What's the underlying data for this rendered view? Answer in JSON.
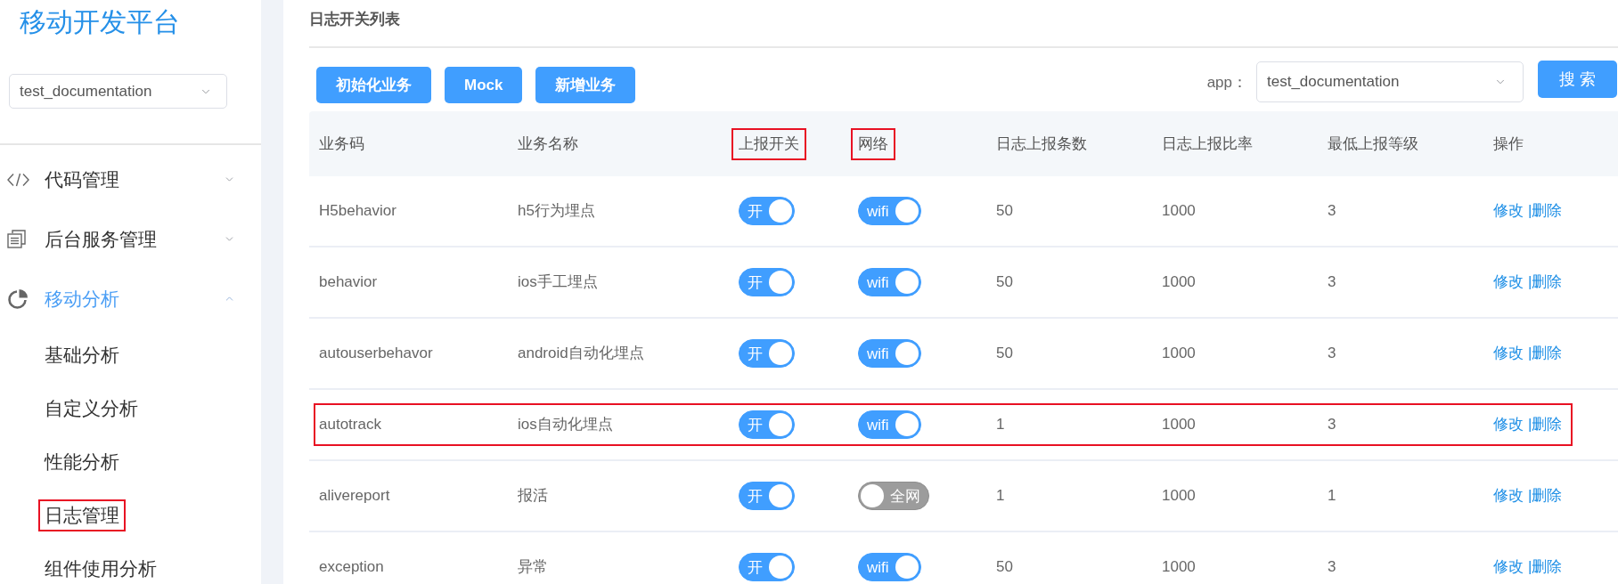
{
  "sidebar": {
    "title": "移动开发平台",
    "app_select": {
      "value": "test_documentation"
    },
    "menu": [
      {
        "kind": "code",
        "label": "代码管理",
        "expanded": false
      },
      {
        "kind": "documents",
        "label": "后台服务管理",
        "expanded": false
      },
      {
        "kind": "chart",
        "label": "移动分析",
        "expanded": true,
        "children": [
          {
            "label": "基础分析",
            "annotated": false
          },
          {
            "label": "自定义分析",
            "annotated": false
          },
          {
            "label": "性能分析",
            "annotated": false
          },
          {
            "label": "日志管理",
            "annotated": true
          },
          {
            "label": "组件使用分析",
            "annotated": false
          }
        ]
      }
    ]
  },
  "content": {
    "title": "日志开关列表",
    "buttons": [
      "初始化业务",
      "Mock",
      "新增业务"
    ],
    "app_filter": {
      "label": "app：",
      "value": "test_documentation"
    },
    "search_button": "搜 索"
  },
  "table": {
    "columns": [
      {
        "label": "业务码",
        "annotated": false
      },
      {
        "label": "业务名称",
        "annotated": false
      },
      {
        "label": "上报开关",
        "annotated": true
      },
      {
        "label": "网络",
        "annotated": true
      },
      {
        "label": "日志上报条数",
        "annotated": false
      },
      {
        "label": "日志上报比率",
        "annotated": false
      },
      {
        "label": "最低上报等级",
        "annotated": false
      },
      {
        "label": "操作",
        "annotated": false
      }
    ],
    "rows": [
      {
        "code": "H5behavior",
        "name": "h5行为埋点",
        "report_switch": {
          "on": true,
          "label": "开"
        },
        "network_switch": {
          "on": true,
          "label": "wifi"
        },
        "log_count": "50",
        "log_ratio": "1000",
        "min_level": "3",
        "actions": [
          "修改",
          "|删除"
        ],
        "annotated": false
      },
      {
        "code": "behavior",
        "name": "ios手工埋点",
        "report_switch": {
          "on": true,
          "label": "开"
        },
        "network_switch": {
          "on": true,
          "label": "wifi"
        },
        "log_count": "50",
        "log_ratio": "1000",
        "min_level": "3",
        "actions": [
          "修改",
          "|删除"
        ],
        "annotated": false
      },
      {
        "code": "autouserbehavor",
        "name": "android自动化埋点",
        "report_switch": {
          "on": true,
          "label": "开"
        },
        "network_switch": {
          "on": true,
          "label": "wifi"
        },
        "log_count": "50",
        "log_ratio": "1000",
        "min_level": "3",
        "actions": [
          "修改",
          "|删除"
        ],
        "annotated": false
      },
      {
        "code": "autotrack",
        "name": "ios自动化埋点",
        "report_switch": {
          "on": true,
          "label": "开"
        },
        "network_switch": {
          "on": true,
          "label": "wifi"
        },
        "log_count": "1",
        "log_ratio": "1000",
        "min_level": "3",
        "actions": [
          "修改",
          "|删除"
        ],
        "annotated": true
      },
      {
        "code": "alivereport",
        "name": "报活",
        "report_switch": {
          "on": true,
          "label": "开"
        },
        "network_switch": {
          "on": false,
          "label": "全网"
        },
        "log_count": "1",
        "log_ratio": "1000",
        "min_level": "1",
        "actions": [
          "修改",
          "|删除"
        ],
        "annotated": false
      },
      {
        "code": "exception",
        "name": "异常",
        "report_switch": {
          "on": true,
          "label": "开"
        },
        "network_switch": {
          "on": true,
          "label": "wifi"
        },
        "log_count": "50",
        "log_ratio": "1000",
        "min_level": "3",
        "actions": [
          "修改",
          "|删除"
        ],
        "annotated": false
      }
    ]
  }
}
